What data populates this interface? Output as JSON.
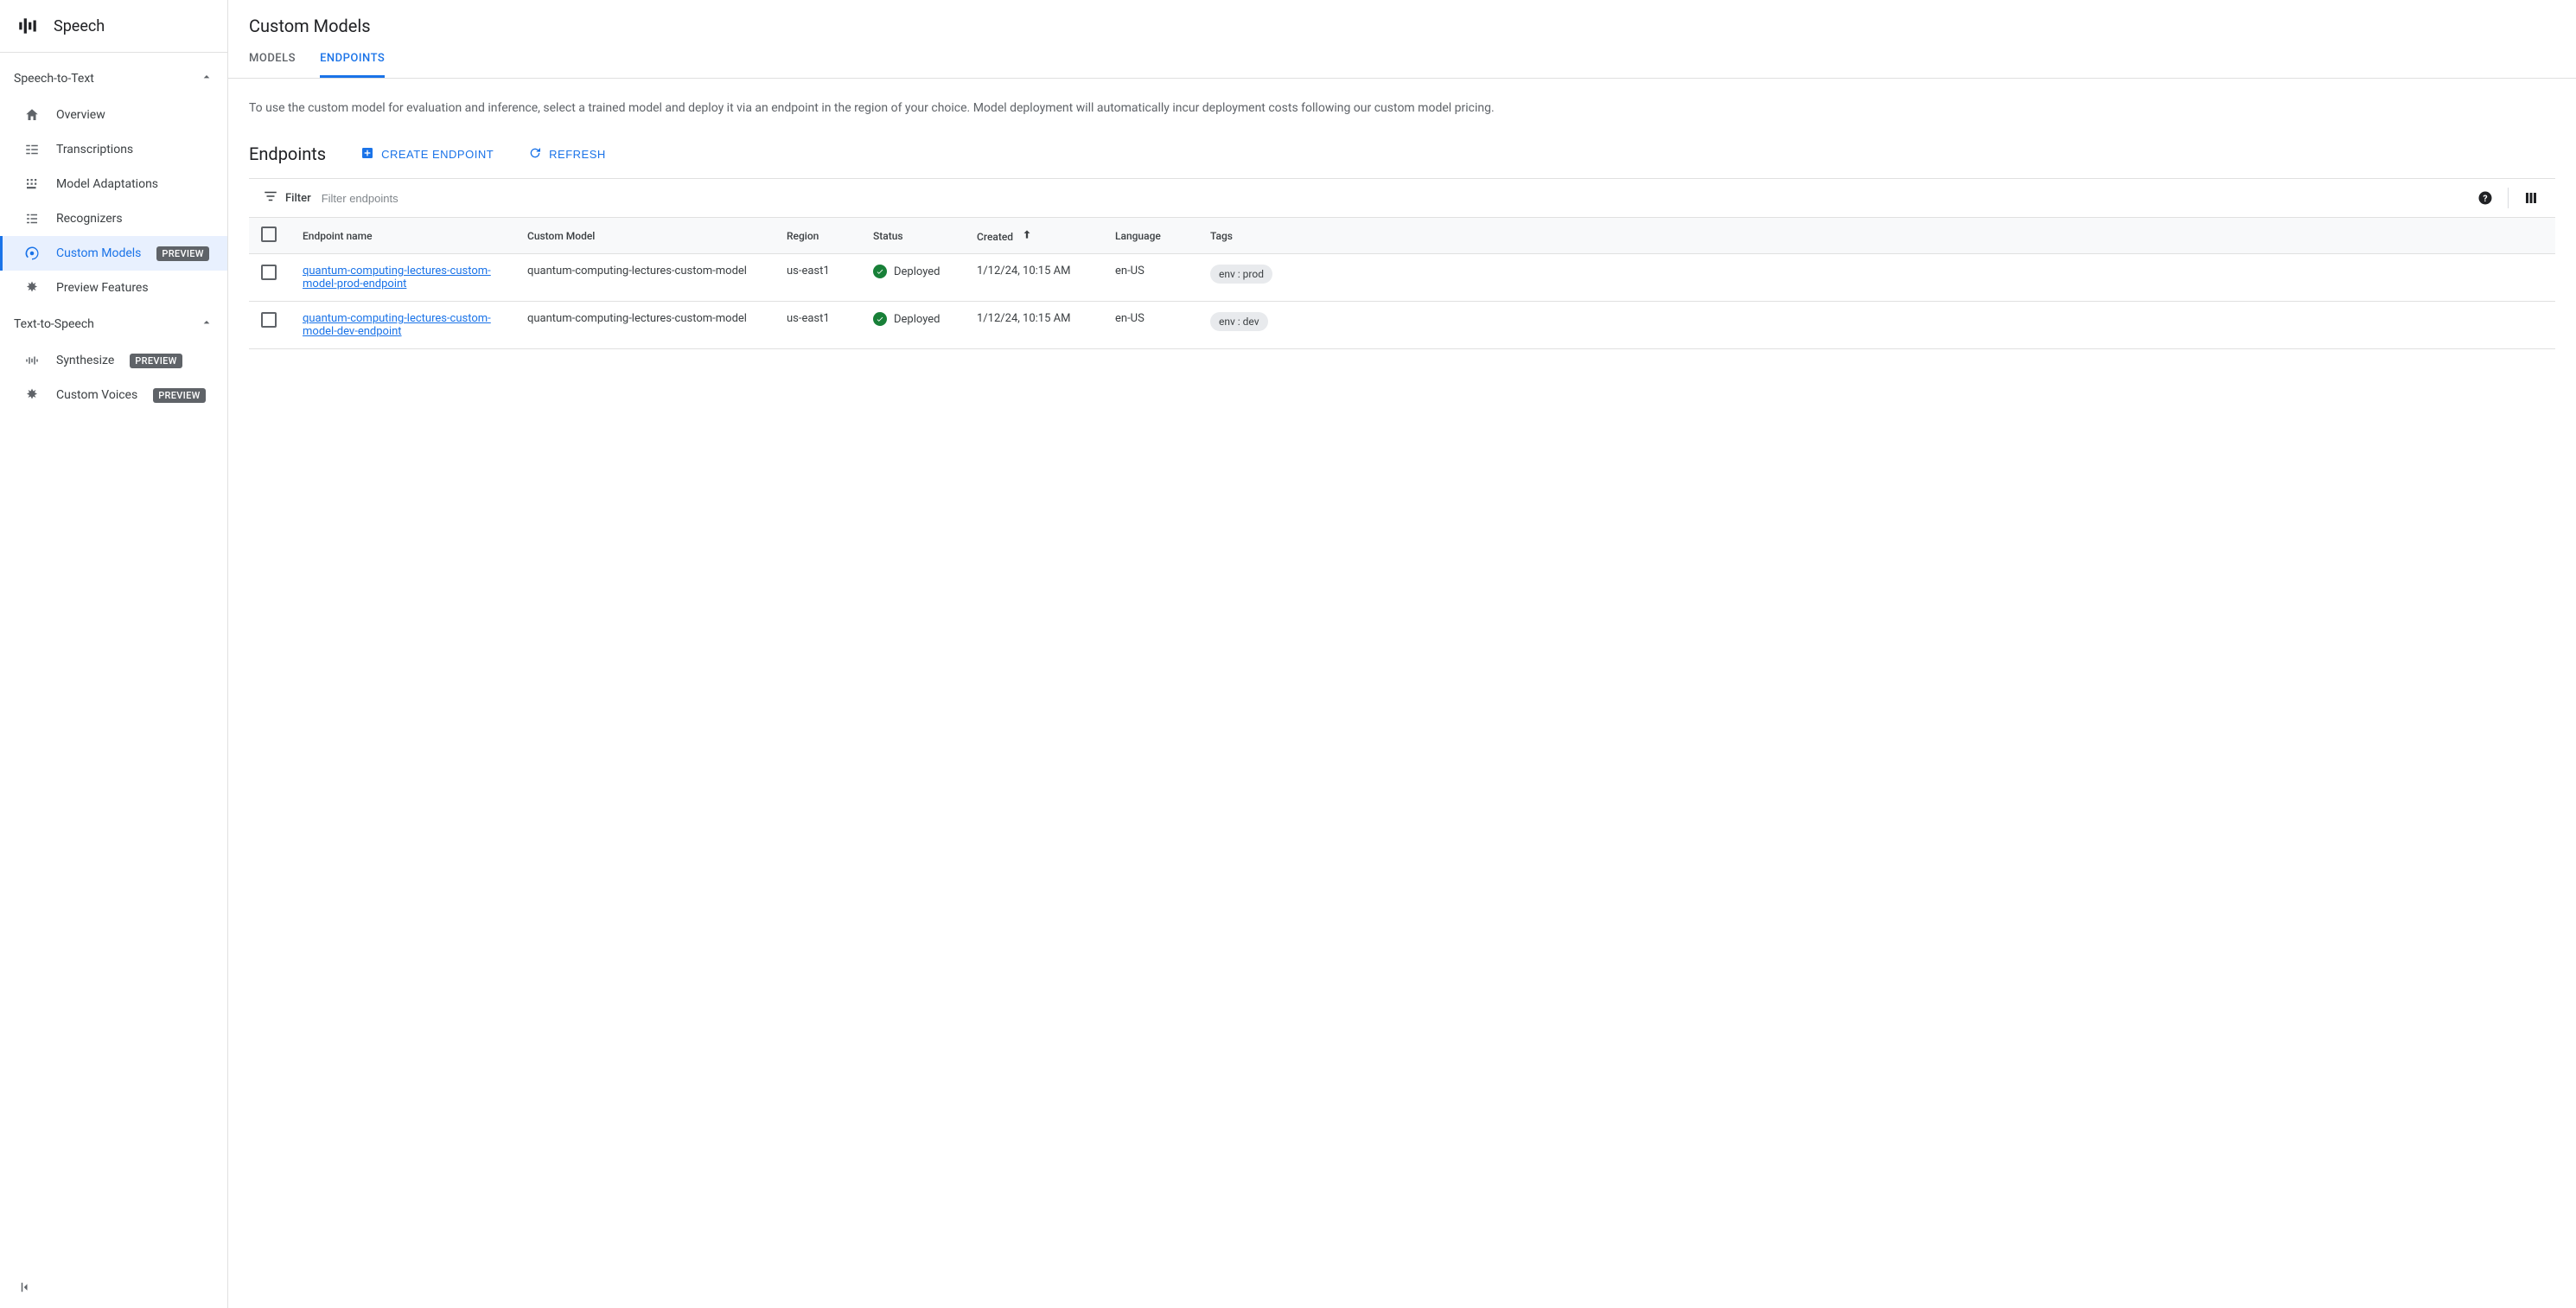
{
  "sidebar": {
    "product_title": "Speech",
    "sections": [
      {
        "label": "Speech-to-Text",
        "items": [
          {
            "label": "Overview",
            "icon": "home"
          },
          {
            "label": "Transcriptions",
            "icon": "transcriptions"
          },
          {
            "label": "Model Adaptations",
            "icon": "adaptations"
          },
          {
            "label": "Recognizers",
            "icon": "recognizers"
          },
          {
            "label": "Custom Models",
            "icon": "custom-models",
            "preview": true,
            "active": true
          },
          {
            "label": "Preview Features",
            "icon": "preview-features"
          }
        ]
      },
      {
        "label": "Text-to-Speech",
        "items": [
          {
            "label": "Synthesize",
            "icon": "synthesize",
            "preview": true
          },
          {
            "label": "Custom Voices",
            "icon": "custom-voices",
            "preview": true
          }
        ]
      }
    ],
    "preview_label": "PREVIEW"
  },
  "page": {
    "title": "Custom Models",
    "tabs": [
      {
        "label": "MODELS",
        "active": false
      },
      {
        "label": "ENDPOINTS",
        "active": true
      }
    ],
    "description": "To use the custom model for evaluation and inference, select a trained model and deploy it via an endpoint in the region of your choice. Model deployment will automatically incur deployment costs following our custom model pricing.",
    "section_title": "Endpoints",
    "create_label": "CREATE ENDPOINT",
    "refresh_label": "REFRESH",
    "filter_label": "Filter",
    "filter_placeholder": "Filter endpoints"
  },
  "table": {
    "headers": {
      "name": "Endpoint name",
      "model": "Custom Model",
      "region": "Region",
      "status": "Status",
      "created": "Created",
      "language": "Language",
      "tags": "Tags"
    },
    "rows": [
      {
        "name": "quantum-computing-lectures-custom-model-prod-endpoint",
        "model": "quantum-computing-lectures-custom-model",
        "region": "us-east1",
        "status": "Deployed",
        "created": "1/12/24, 10:15 AM",
        "language": "en-US",
        "tags": "env : prod"
      },
      {
        "name": "quantum-computing-lectures-custom-model-dev-endpoint",
        "model": "quantum-computing-lectures-custom-model",
        "region": "us-east1",
        "status": "Deployed",
        "created": "1/12/24, 10:15 AM",
        "language": "en-US",
        "tags": "env : dev"
      }
    ]
  }
}
